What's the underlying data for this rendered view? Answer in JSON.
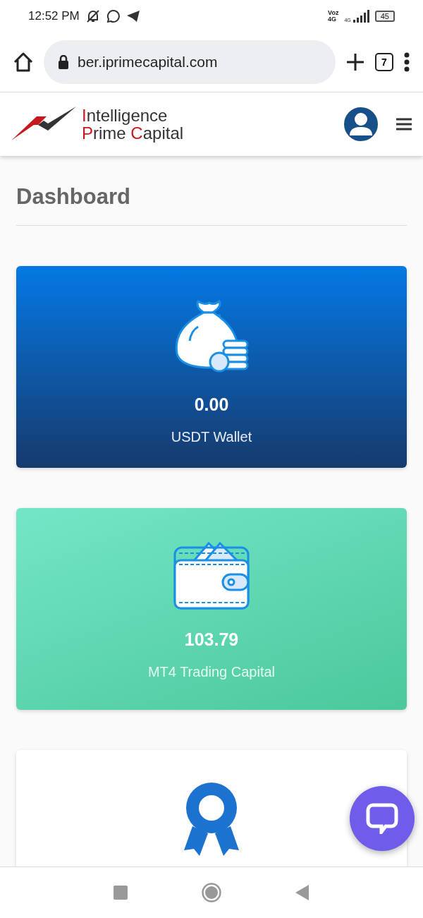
{
  "status_bar": {
    "time": "12:52 PM",
    "network_label": "Voz\n4G",
    "signal_label": "4G",
    "battery": "45"
  },
  "browser": {
    "url": "ber.iprimecapital.com",
    "tab_count": "7"
  },
  "site_header": {
    "logo_lines": [
      [
        {
          "text": "I",
          "accent": true
        },
        {
          "text": "ntelligence",
          "accent": false
        }
      ],
      [
        {
          "text": "P",
          "accent": true
        },
        {
          "text": "rime ",
          "accent": false
        },
        {
          "text": "C",
          "accent": true
        },
        {
          "text": "apital",
          "accent": false
        }
      ]
    ]
  },
  "page_title": "Dashboard",
  "cards": [
    {
      "kind": "wallet-blue",
      "value": "0.00",
      "label": "USDT Wallet"
    },
    {
      "kind": "trading-green",
      "value": "103.79",
      "label": "MT4 Trading Capital"
    },
    {
      "kind": "award-white"
    }
  ]
}
